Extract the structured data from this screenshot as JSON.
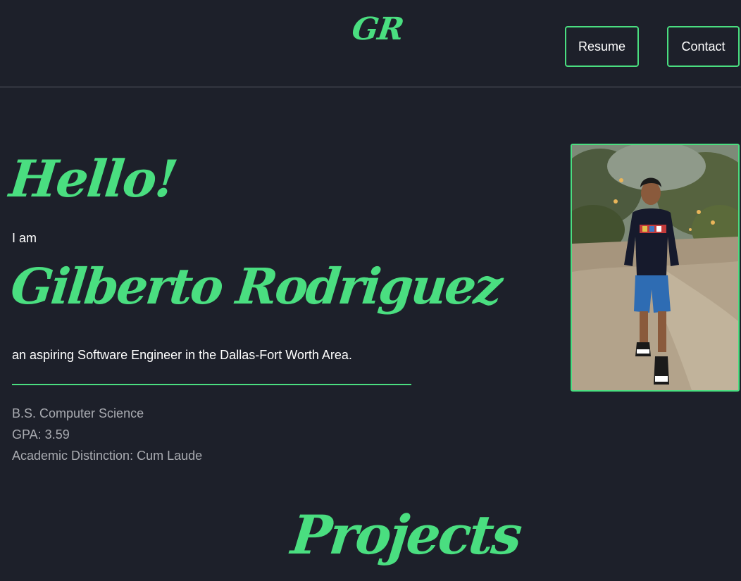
{
  "header": {
    "logo": "GR",
    "nav": {
      "resume_label": "Resume",
      "contact_label": "Contact"
    }
  },
  "hero": {
    "greeting": "Hello!",
    "intro": "I am",
    "name": "Gilberto Rodriguez",
    "tagline": "an aspiring Software Engineer in the Dallas-Fort Worth Area.",
    "education": [
      "B.S. Computer Science",
      "GPA: 3.59",
      "Academic Distinction: Cum Laude"
    ],
    "photo": "profile-photo"
  },
  "projects": {
    "heading": "Projects"
  },
  "colors": {
    "accent": "#4ade80",
    "background": "#1d202a",
    "text": "#ffffff",
    "muted_text": "#a9abb1"
  }
}
